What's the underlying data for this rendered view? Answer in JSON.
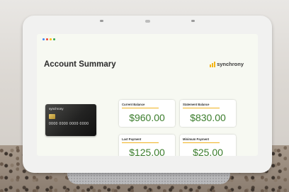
{
  "device": {
    "type": "smart display",
    "dots_colors": [
      "#4285f4",
      "#ea4335",
      "#fbbc04",
      "#34a853"
    ]
  },
  "screen": {
    "title": "Account Summary",
    "logo": {
      "text": "synchrony",
      "mark_color": "#f3b519"
    },
    "card": {
      "brand": "synchrony",
      "number": "0000 0000 0000 0000"
    },
    "tiles": [
      {
        "label": "Current Balance",
        "amount": "$960.00",
        "due": ""
      },
      {
        "label": "Statement Balance",
        "amount": "$830.00",
        "due": ""
      },
      {
        "label": "Last Payment",
        "amount": "$125.00",
        "due": ""
      },
      {
        "label": "Minimum Payment",
        "amount": "$25.00",
        "due": ""
      }
    ],
    "accent_color": "#f0b21f",
    "amount_color": "#3b7d2c"
  }
}
